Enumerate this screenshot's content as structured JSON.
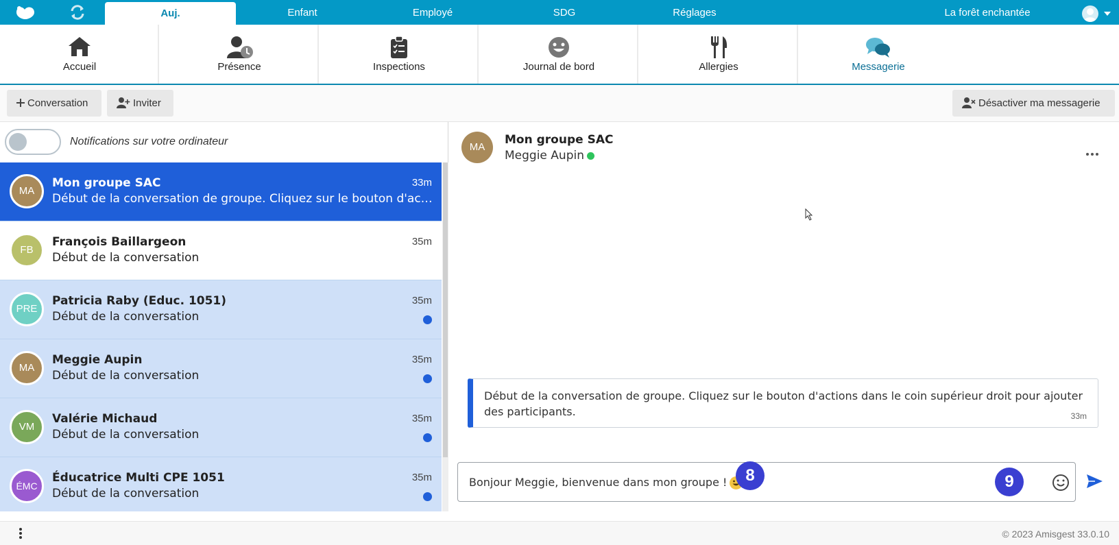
{
  "topnav": {
    "tabs": [
      {
        "label": "Auj.",
        "active": true
      },
      {
        "label": "Enfant"
      },
      {
        "label": "Employé"
      },
      {
        "label": "SDG"
      },
      {
        "label": "Réglages"
      }
    ],
    "organization": "La forêt enchantée",
    "icons": [
      "logo-icon",
      "refresh-icon",
      "user-icon",
      "caret-down-icon"
    ]
  },
  "modules": [
    {
      "label": "Accueil",
      "icon": "home-icon"
    },
    {
      "label": "Présence",
      "icon": "presence-icon"
    },
    {
      "label": "Inspections",
      "icon": "clipboard-icon"
    },
    {
      "label": "Journal de bord",
      "icon": "face-icon"
    },
    {
      "label": "Allergies",
      "icon": "utensils-icon"
    },
    {
      "label": "Messagerie",
      "icon": "chat-icon",
      "active": true
    }
  ],
  "toolbar": {
    "conversation_label": "Conversation",
    "invite_label": "Inviter",
    "disable_label": "Désactiver ma messagerie"
  },
  "notifications": {
    "label": "Notifications sur votre ordinateur",
    "enabled": false
  },
  "conversations": [
    {
      "initials": "MA",
      "name": "Mon groupe SAC",
      "time": "33m",
      "preview": "Début de la conversation de groupe. Cliquez sur le bouton d'actions dans le coin supérieur droit pour ajouter des participants.",
      "state": "selected",
      "color": "#a98a5a",
      "unread": false
    },
    {
      "initials": "FB",
      "name": "François Baillargeon",
      "time": "35m",
      "preview": "Début de la conversation",
      "state": "read",
      "color": "#b9c06a",
      "unread": false
    },
    {
      "initials": "PRE",
      "name": "Patricia Raby (Educ. 1051)",
      "time": "35m",
      "preview": "Début de la conversation",
      "state": "unread",
      "color": "#6fd0c4",
      "unread": true
    },
    {
      "initials": "MA",
      "name": "Meggie Aupin",
      "time": "35m",
      "preview": "Début de la conversation",
      "state": "unread",
      "color": "#a98a5a",
      "unread": true
    },
    {
      "initials": "VM",
      "name": "Valérie Michaud",
      "time": "35m",
      "preview": "Début de la conversation",
      "state": "unread",
      "color": "#7aa85a",
      "unread": true
    },
    {
      "initials": "ÉMC",
      "name": "Éducatrice Multi CPE 1051",
      "time": "35m",
      "preview": "Début de la conversation",
      "state": "unread",
      "color": "#9a5ad0",
      "unread": true
    }
  ],
  "chat": {
    "avatar_initials": "MA",
    "title": "Mon groupe SAC",
    "member": "Meggie Aupin",
    "member_online": true,
    "system_message": "Début de la conversation de groupe. Cliquez sur le bouton d'actions dans le coin supérieur droit pour ajouter des participants.",
    "system_time": "33m",
    "input_value": "Bonjour Meggie, bienvenue dans mon groupe !",
    "badge_input": "8",
    "badge_emoji": "9"
  },
  "footer": {
    "copyright": "© 2023 Amisgest 33.0.10"
  },
  "colors": {
    "brand": "#0499c6",
    "selected": "#1f5fd9",
    "unread_bg": "#cfe0f8",
    "badge": "#3a3fd1",
    "online": "#2ec45c"
  }
}
